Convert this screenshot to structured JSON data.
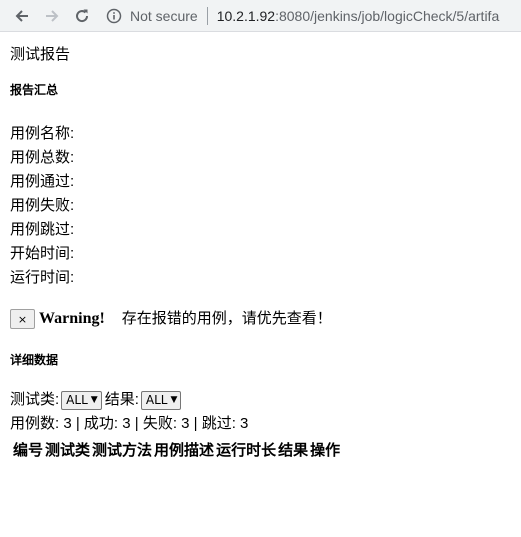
{
  "browser": {
    "security_label": "Not secure",
    "url_host": "10.2.1.92",
    "url_rest": ":8080/jenkins/job/logicCheck/5/artifa"
  },
  "report": {
    "title": "测试报告",
    "summary_heading": "报告汇总",
    "stats": [
      {
        "label": "用例名称:",
        "value": ""
      },
      {
        "label": "用例总数:",
        "value": ""
      },
      {
        "label": "用例通过:",
        "value": ""
      },
      {
        "label": "用例失败:",
        "value": ""
      },
      {
        "label": "用例跳过:",
        "value": ""
      },
      {
        "label": "开始时间:",
        "value": ""
      },
      {
        "label": "运行时间:",
        "value": ""
      }
    ],
    "warning": {
      "close_glyph": "×",
      "label": "Warning!",
      "message": "存在报错的用例，请优先查看！"
    },
    "detail_heading": "详细数据",
    "filters": {
      "class_label": "测试类:",
      "class_value": "ALL",
      "result_label": "结果:",
      "result_value": "ALL"
    },
    "counts": "用例数: 3 | 成功: 3 | 失败: 3 | 跳过: 3",
    "table_headers": [
      "编号",
      "测试类",
      "测试方法",
      "用例描述",
      "运行时长",
      "结果",
      "操作"
    ]
  }
}
